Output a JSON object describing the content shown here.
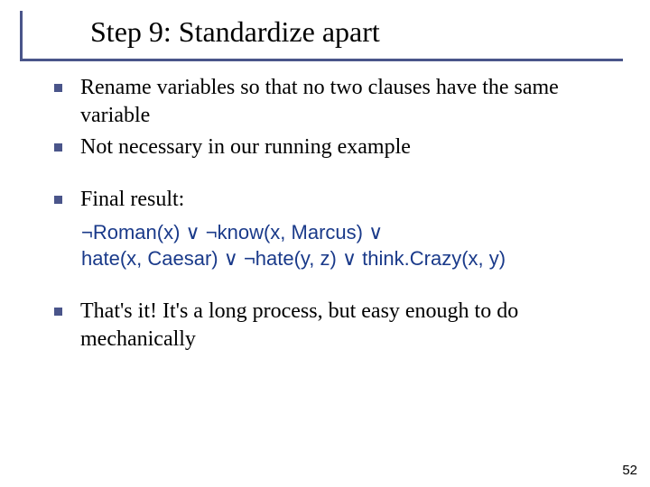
{
  "title": "Step 9: Standardize apart",
  "bullets": {
    "b1": "Rename variables so that no two clauses have the same variable",
    "b2": "Not necessary in our running example",
    "b3": "Final result:",
    "b4": "That's it! It's a long process, but easy enough to do mechanically"
  },
  "formula": {
    "line1": "¬Roman(x) ∨ ¬know(x, Marcus) ∨",
    "line2": "hate(x, Caesar)  ∨ ¬hate(y, z) ∨ think.Crazy(x, y)"
  },
  "page_number": "52",
  "colors": {
    "accent": "#4a558a",
    "formula": "#1a3a8a"
  }
}
